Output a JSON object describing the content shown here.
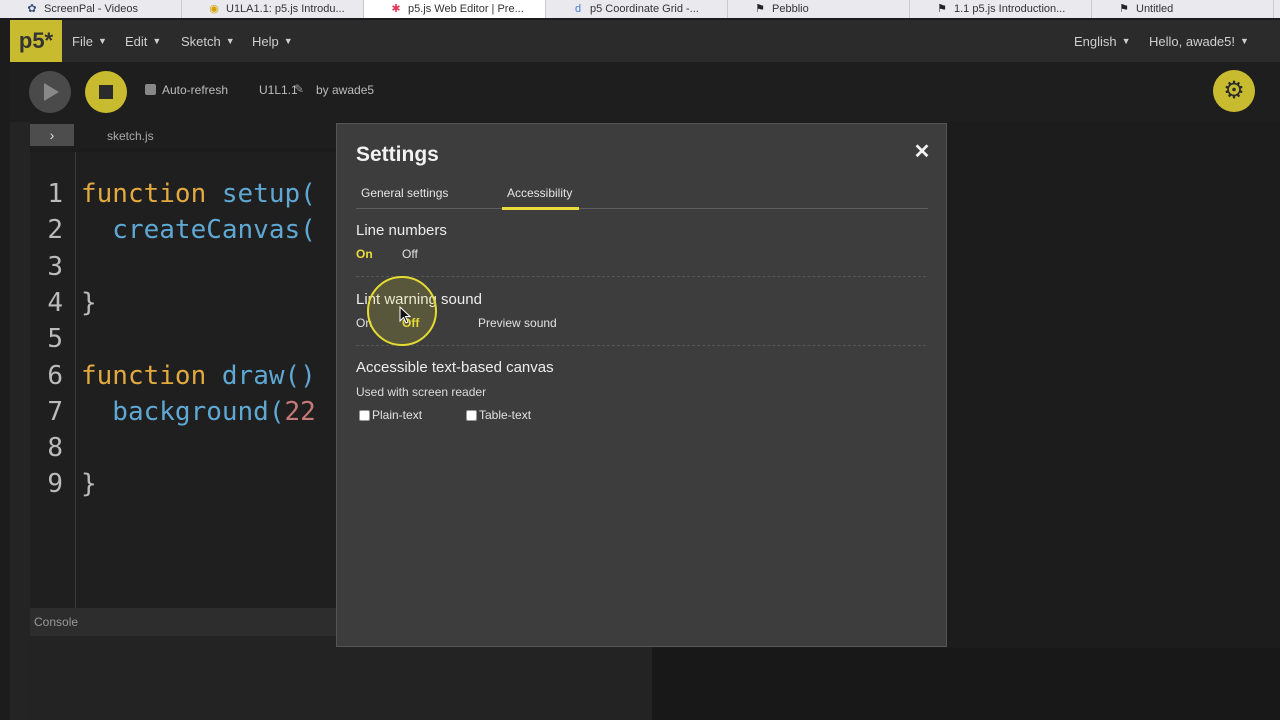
{
  "browser": {
    "tabs": [
      {
        "label": "ScreenPal - Videos",
        "icon": "screenpal-icon",
        "glyph": "✿",
        "color": "#3b4a7a"
      },
      {
        "label": "U1LA1.1: p5.js Introdu...",
        "icon": "lesson-icon",
        "glyph": "◉",
        "color": "#d6a400"
      },
      {
        "label": "p5.js Web Editor | Pre...",
        "icon": "p5-star-icon",
        "glyph": "✱",
        "color": "#e23a5b"
      },
      {
        "label": "p5 Coordinate Grid -...",
        "icon": "desmos-icon",
        "glyph": "d",
        "color": "#4a7fd1"
      },
      {
        "label": "Pebblio",
        "icon": "pin-icon",
        "glyph": "⚑",
        "color": "#222222"
      },
      {
        "label": "1.1 p5.js Introduction...",
        "icon": "pin-icon",
        "glyph": "⚑",
        "color": "#222222"
      },
      {
        "label": "Untitled",
        "icon": "pin-icon",
        "glyph": "⚑",
        "color": "#222222"
      }
    ]
  },
  "app": {
    "logo": "p5*",
    "menus": [
      "File",
      "Edit",
      "Sketch",
      "Help"
    ],
    "language": "English",
    "user": "Hello, awade5!",
    "auto_refresh": "Auto-refresh",
    "sketch_name": "U1L1.1",
    "author": "by awade5",
    "accent": "#c9bb2f"
  },
  "editor": {
    "filename": "sketch.js",
    "line_numbers": [
      "1",
      "2",
      "3",
      "4",
      "5",
      "6",
      "7",
      "8",
      "9"
    ],
    "lines": [
      [
        {
          "t": "function ",
          "c": "#e2a93f"
        },
        {
          "t": "setup(",
          "c": "#5fa8d3"
        }
      ],
      [
        {
          "t": "  createCanvas(",
          "c": "#5fa8d3"
        }
      ],
      [],
      [
        {
          "t": "}",
          "c": "#bbbbbb"
        }
      ],
      [],
      [
        {
          "t": "function ",
          "c": "#e2a93f"
        },
        {
          "t": "draw()",
          "c": "#5fa8d3"
        }
      ],
      [
        {
          "t": "  background(",
          "c": "#5fa8d3"
        },
        {
          "t": "22",
          "c": "#c57a78"
        }
      ],
      [],
      [
        {
          "t": "}",
          "c": "#bbbbbb"
        }
      ]
    ],
    "console_label": "Console"
  },
  "settings": {
    "title": "Settings",
    "tabs": {
      "general": "General settings",
      "accessibility": "Accessibility"
    },
    "line_numbers": {
      "label": "Line numbers",
      "on": "On",
      "off": "Off"
    },
    "lint": {
      "label": "Lint warning sound",
      "on": "On",
      "off": "Off",
      "preview": "Preview sound"
    },
    "canvas": {
      "label": "Accessible text-based canvas",
      "description": "Used with screen reader",
      "plain": "Plain-text",
      "table": "Table-text"
    }
  }
}
